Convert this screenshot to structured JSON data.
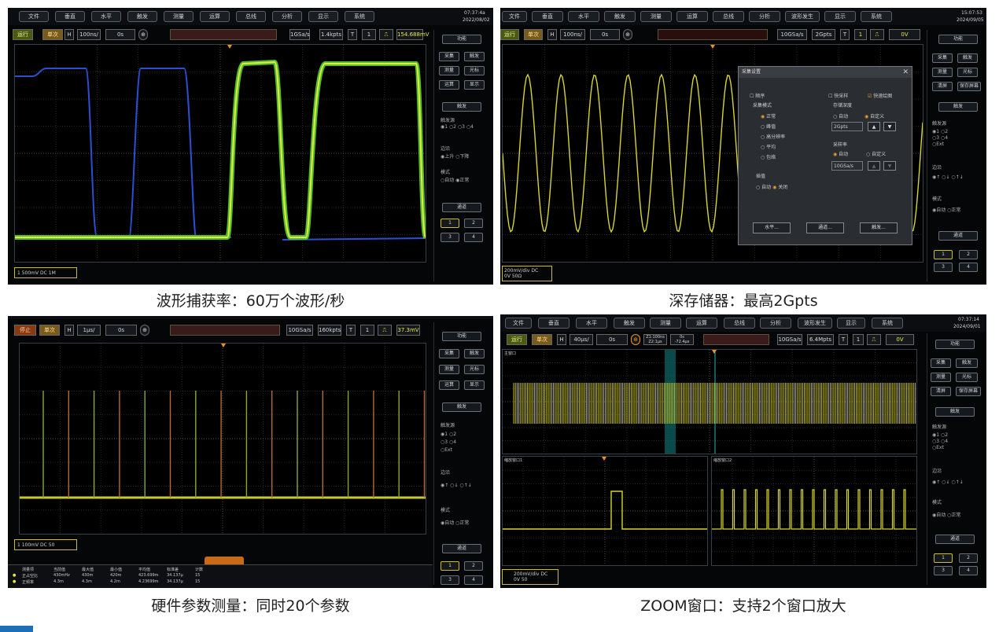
{
  "captions": {
    "p1": "波形捕获率：60万个波形/秒",
    "p2": "深存储器：最高2Gpts",
    "p3": "硬件参数测量：同时20个参数",
    "p4": "ZOOM窗口：支持2个窗口放大"
  },
  "menu": [
    "文件",
    "垂直",
    "水平",
    "触发",
    "测量",
    "运算",
    "总线",
    "分析",
    "波形发生",
    "显示",
    "系统"
  ],
  "menu_short": [
    "文件",
    "垂直",
    "水平",
    "触发",
    "测量",
    "运算",
    "总线",
    "分析",
    "显示",
    "系统"
  ],
  "side": {
    "func": "功能",
    "acquire": "采集",
    "trigger_btn": "触发",
    "measure": "测量",
    "cursor": "光标",
    "clear": "清屏",
    "save": "保存屏幕",
    "display": "显示",
    "trigger_section": "触发",
    "trig_source": "触发源",
    "src_options": [
      "1",
      "2",
      "3",
      "4",
      "Ext"
    ],
    "edge": "边沿",
    "edge_options": "↑ ○↓ ○↑↓",
    "mode": "模式",
    "mode_auto": "自动",
    "mode_normal": "正常",
    "channel": "通道",
    "channels": [
      "1",
      "2",
      "3",
      "4"
    ],
    "rising": "上升",
    "falling": "下降"
  },
  "p1": {
    "run": "运行",
    "single": "单次",
    "h": "H",
    "timebase": "100ns/",
    "offset": "0s",
    "rate": "1GSa/s",
    "depth": "1.4kpts",
    "t": "T",
    "tch": "1",
    "tlevel": "154.688mV",
    "status": "1   500mV   DC   1M",
    "clock": "07:37:4a",
    "date": "2022/08/02"
  },
  "p2": {
    "run": "运行",
    "single": "单次",
    "h": "H",
    "timebase": "100ns/",
    "offset": "0s",
    "rate": "10GSa/s",
    "depth": "2Gpts",
    "t": "T",
    "tch": "1",
    "tlevel": "0V",
    "status1": "200mV/div   DC",
    "status2": "0V   50Ω",
    "clock": "15:07:53",
    "date": "2024/09/05",
    "dialog": {
      "title": "采集设置",
      "seq": "顺序",
      "fast": "快采样",
      "fastplot": "快速绘图",
      "acq_mode": "采集模式",
      "modes": [
        "正常",
        "峰值",
        "高分辨率",
        "平均",
        "包络"
      ],
      "depth_label": "存储深度",
      "auto": "自动",
      "custom": "自定义",
      "depth_val": "2Gpts",
      "sample_rate": "采样率",
      "sr_auto": "自动",
      "sr_custom": "自定义",
      "sr_val": "10GSa/s",
      "interp": "插值",
      "interp_auto": "自动",
      "interp_off": "关闭",
      "btn_h": "水平...",
      "btn_ch": "通道...",
      "btn_trig": "触发..."
    }
  },
  "p3": {
    "stop": "停止",
    "single": "单次",
    "h": "H",
    "timebase": "1μs/",
    "offset": "0s",
    "rate": "10GSa/s",
    "depth": "160kpts",
    "t": "T",
    "tch": "1",
    "tlevel": "37.3mV",
    "status": "1   100mV   DC   50",
    "table_headers": [
      "测量项",
      "当前值",
      "最大值",
      "最小值",
      "平均值",
      "标准差",
      "计数"
    ],
    "rows": [
      [
        "正占空比",
        "430mHz",
        "430m",
        "420m",
        "423.699m",
        "34.137μ",
        "15"
      ],
      [
        "正频率",
        "4.3m",
        "4.3m",
        "4.2m",
        "4.23699m",
        "34.137μ",
        "15"
      ]
    ]
  },
  "p4": {
    "run": "运行",
    "single": "单次",
    "h": "H",
    "timebase": "40μs/",
    "offset": "0s",
    "z1": "Z1:100ns",
    "z1b": "Z2:1μs",
    "zoff": "0s",
    "zoff2": "-72.4μs",
    "rate": "10GSa/s",
    "depth": "6.4Mpts",
    "t": "T",
    "tch": "1",
    "tlevel": "0V",
    "main_label": "主窗口",
    "z1_label": "缩放窗口1",
    "z2_label": "缩放窗口2",
    "status1": "200mV/div   DC",
    "status2": "0V   50",
    "clock": "07:37:14",
    "date": "2024/09/01"
  }
}
